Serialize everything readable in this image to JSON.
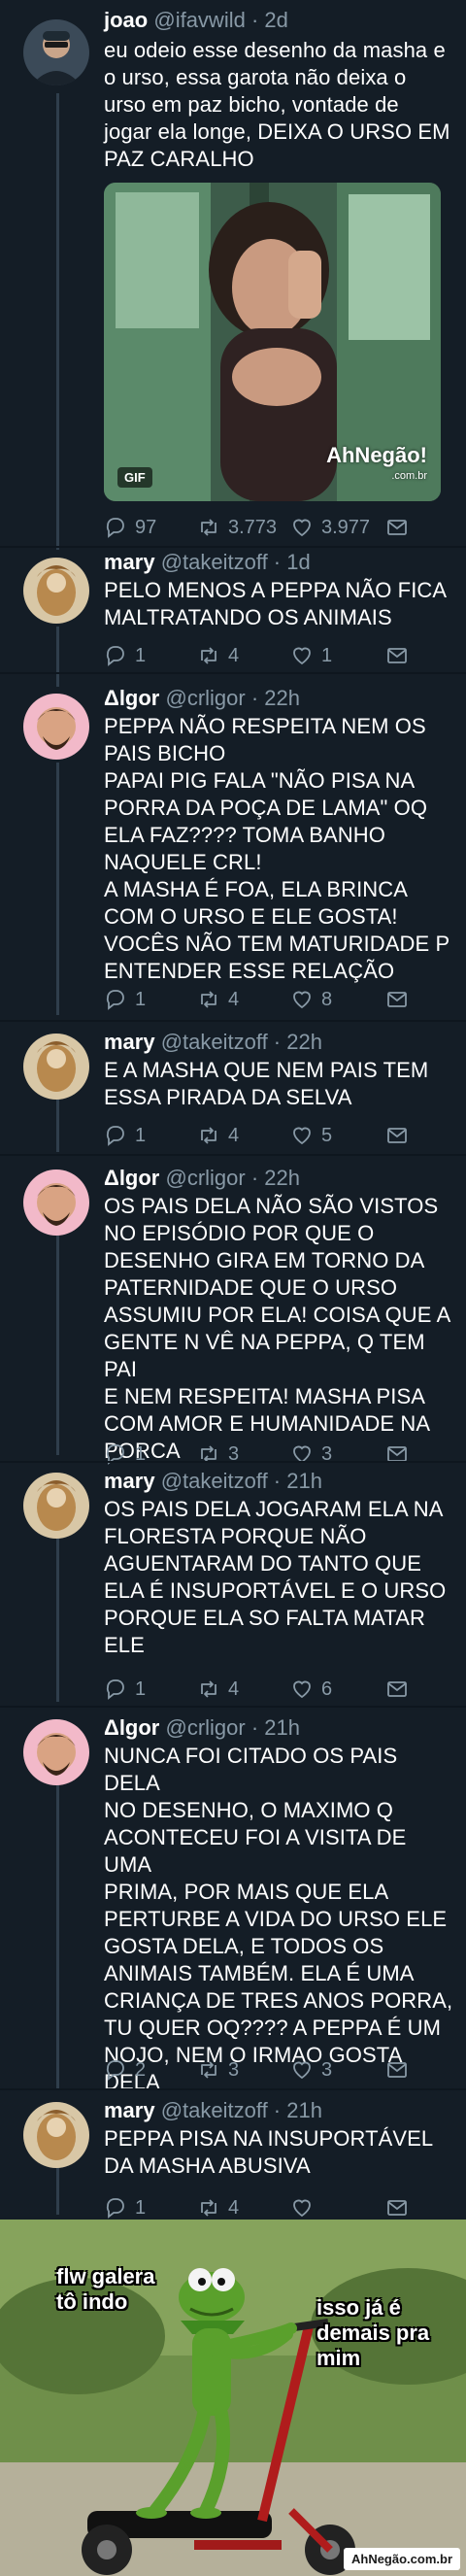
{
  "tweets": [
    {
      "name": "joao",
      "handle": "@ifavwild · 2d",
      "text": "eu odeio esse desenho da masha e\no urso, essa garota não deixa o\nurso em paz bicho, vontade de\njogar ela longe, DEIXA O URSO EM\nPAZ CARALHO",
      "replies": "97",
      "retweets": "3.773",
      "likes": "3.977",
      "gif_badge": "GIF",
      "gif_watermark": "AhNegão!",
      "gif_watermark_sub": ".com.br"
    },
    {
      "name": "mary",
      "handle": "@takeitzoff · 1d",
      "text": "PELO MENOS A PEPPA NÃO FICA\nMALTRATANDO OS ANIMAIS",
      "replies": "1",
      "retweets": "4",
      "likes": "1"
    },
    {
      "name": "Δlgor",
      "handle": "@crligor · 22h",
      "text": "PEPPA NÃO RESPEITA NEM OS\nPAIS BICHO\nPAPAI PIG FALA \"NÃO PISA NA\nPORRA DA POÇA DE LAMA\" OQ\nELA FAZ???? TOMA BANHO\nNAQUELE CRL!\nA MASHA É FOA, ELA BRINCA\nCOM O URSO E ELE GOSTA!\nVOCÊS NÃO TEM MATURIDADE P\nENTENDER ESSE RELAÇÃO",
      "replies": "1",
      "retweets": "4",
      "likes": "8"
    },
    {
      "name": "mary",
      "handle": "@takeitzoff · 22h",
      "text": "E A MASHA QUE NEM PAIS TEM\nESSA PIRADA DA SELVA",
      "replies": "1",
      "retweets": "4",
      "likes": "5"
    },
    {
      "name": "Δlgor",
      "handle": "@crligor · 22h",
      "text": "OS PAIS DELA NÃO SÃO VISTOS\nNO EPISÓDIO POR QUE O\nDESENHO GIRA EM TORNO DA\nPATERNIDADE QUE O URSO\nASSUMIU POR ELA! COISA QUE A\nGENTE N VÊ NA PEPPA, Q TEM PAI\nE NEM RESPEITA! MASHA PISA\nCOM AMOR E HUMANIDADE NA\nPORCA",
      "replies": "1",
      "retweets": "3",
      "likes": "3"
    },
    {
      "name": "mary",
      "handle": "@takeitzoff · 21h",
      "text": "OS PAIS DELA JOGARAM ELA NA\nFLORESTA PORQUE NÃO\nAGUENTARAM DO TANTO QUE\nELA É INSUPORTÁVEL E O URSO\nPORQUE ELA SO FALTA MATAR\nELE",
      "replies": "1",
      "retweets": "4",
      "likes": "6"
    },
    {
      "name": "Δlgor",
      "handle": "@crligor · 21h",
      "text": "NUNCA FOI CITADO OS PAIS DELA\nNO DESENHO, O MAXIMO Q\nACONTECEU FOI A VISITA DE UMA\nPRIMA, POR MAIS QUE ELA\nPERTURBE A VIDA DO URSO ELE\nGOSTA DELA, E TODOS OS\nANIMAIS TAMBÉM. ELA É UMA\nCRIANÇA DE TRES ANOS PORRA,\nTU QUER OQ???? A PEPPA É UM\nNOJO, NEM O IRMAO GOSTA\nDELA",
      "replies": "2",
      "retweets": "3",
      "likes": "3"
    },
    {
      "name": "mary",
      "handle": "@takeitzoff · 21h",
      "text": "PEPPA PISA NA INSUPORTÁVEL\nDA MASHA ABUSIVA",
      "replies": "1",
      "retweets": "4",
      "likes": ""
    }
  ],
  "meme": {
    "left_caption": "flw galera\ntô indo",
    "right_caption": "isso já é\ndemais pra\nmim",
    "watermark": "AhNegão.com.br"
  },
  "colors": {
    "background": "#141d26",
    "muted": "#8899a6",
    "thread_line": "#2f3e4c"
  },
  "icons": [
    "reply-icon",
    "retweet-icon",
    "like-icon",
    "direct-message-icon"
  ]
}
